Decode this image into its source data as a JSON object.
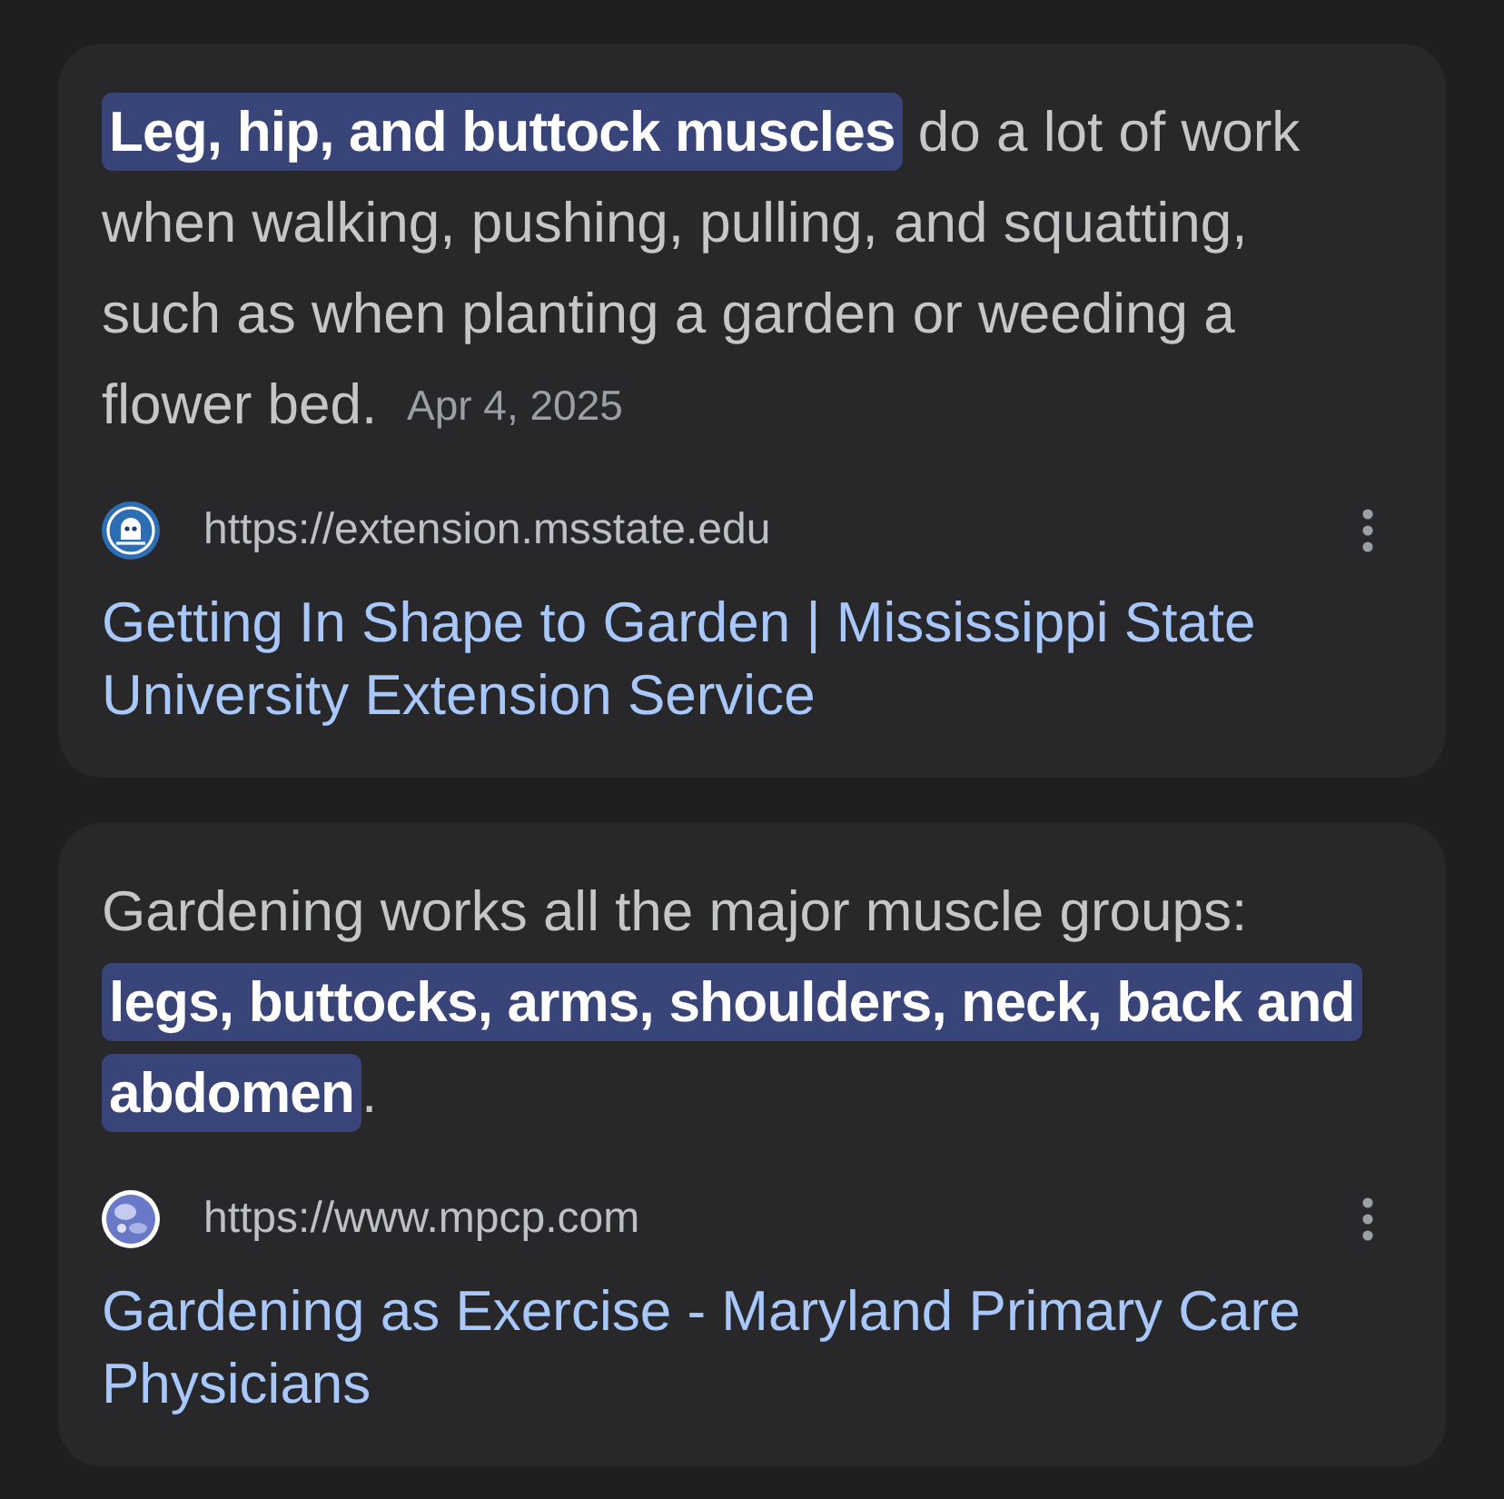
{
  "results": [
    {
      "snippet": "**Leg, hip, and buttock muscles** do a lot of work when walking, pushing, pulling, and squatting, such as when planting a garden or weeding a flower bed.",
      "date": "Apr 4, 2025",
      "source_url": "https://extension.msstate.edu",
      "title": "Getting In Shape to Garden | Mississippi State University Extension Service"
    },
    {
      "snippet": "Gardening works all the major muscle groups: **legs, buttocks, arms, shoulders, neck, back and abdomen**.",
      "source_url": "https://www.mpcp.com",
      "title": "Gardening as Exercise - Maryland Primary Care Physicians"
    }
  ]
}
